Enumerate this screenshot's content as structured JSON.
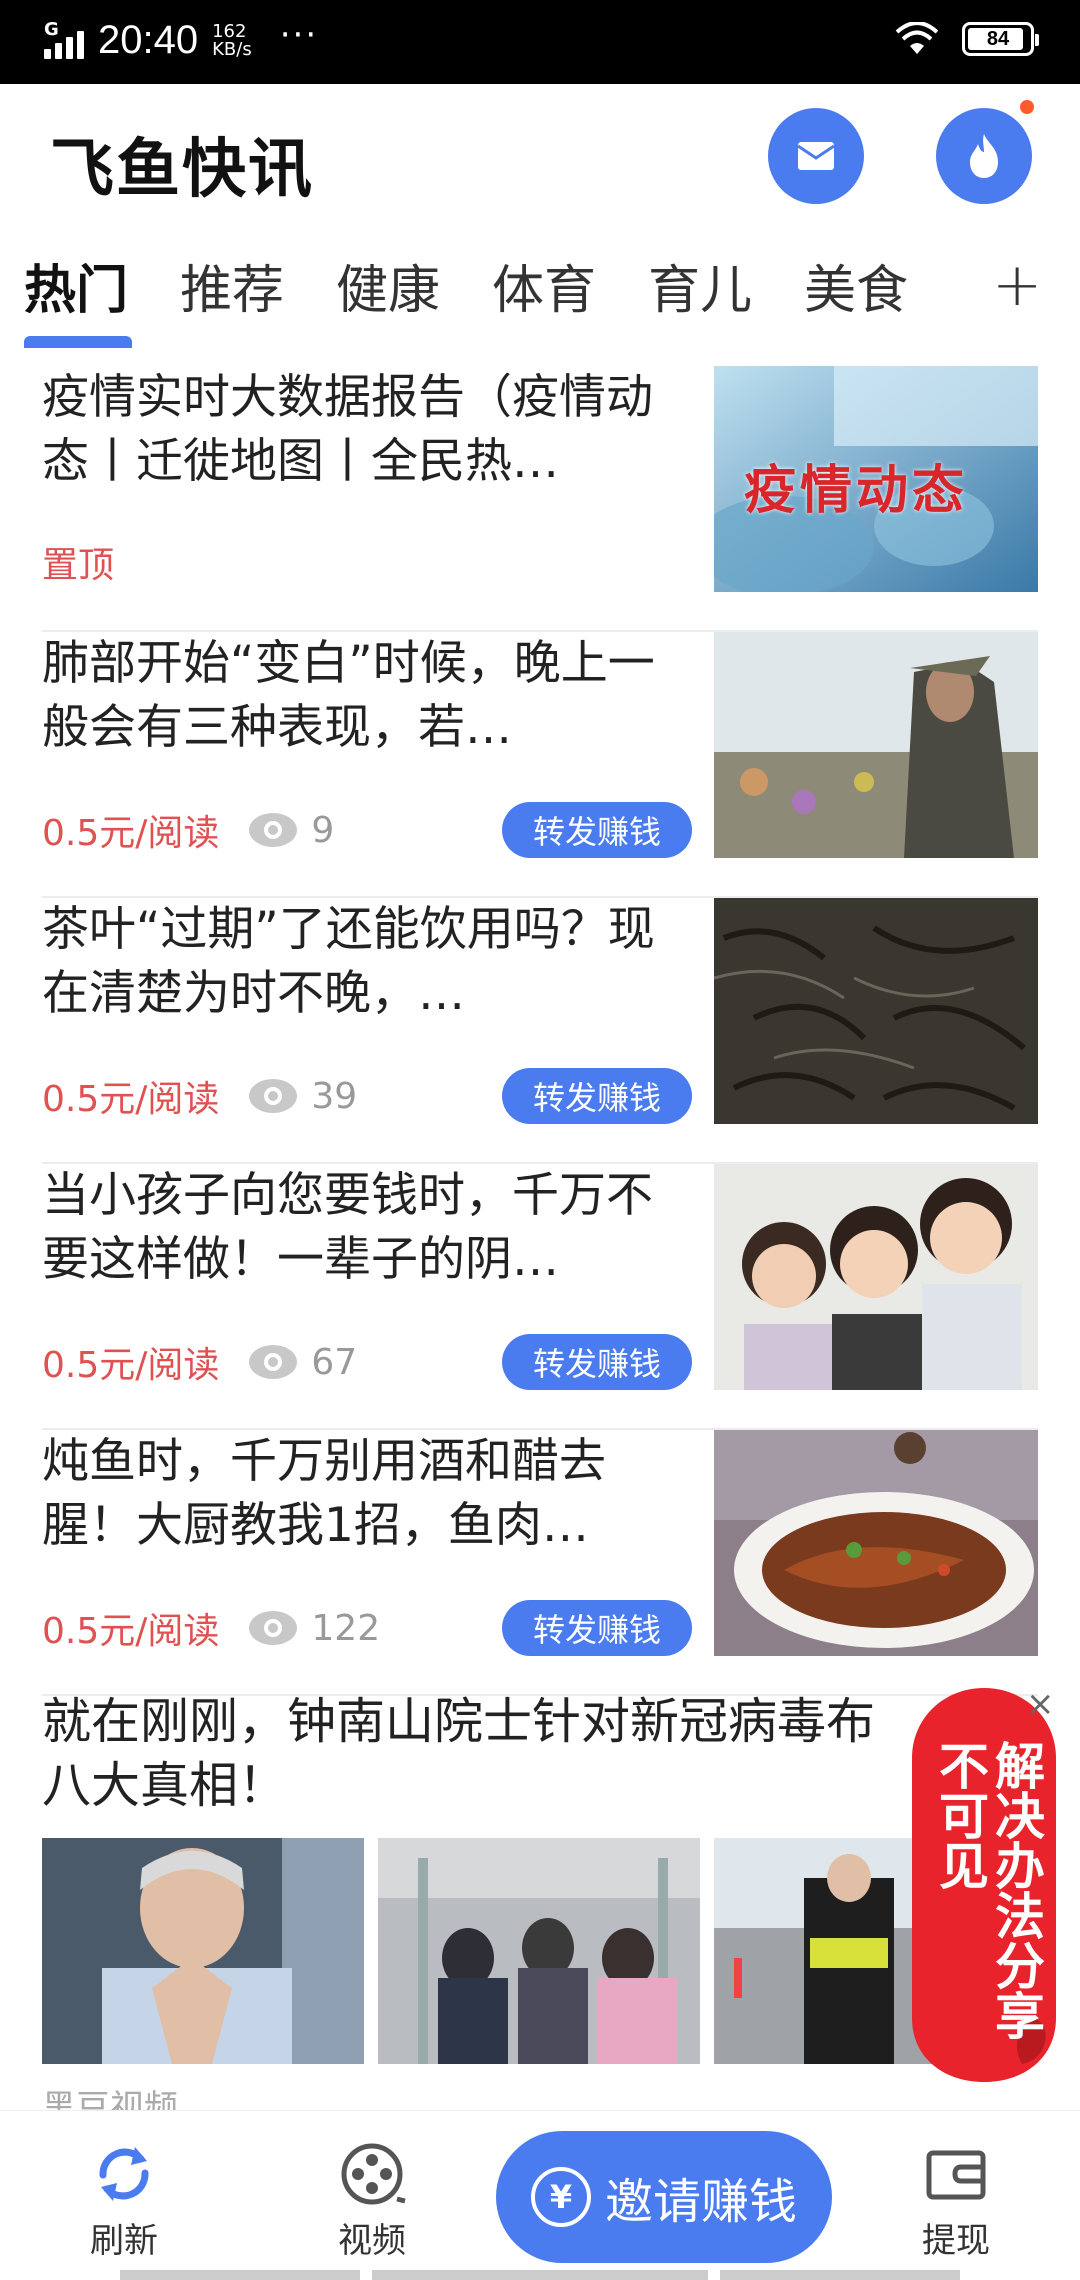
{
  "status_bar": {
    "network": "G",
    "time": "20:40",
    "speed_value": "162",
    "speed_unit": "KB/s",
    "more": "···",
    "battery": "84"
  },
  "header": {
    "title": "飞鱼快讯",
    "mail_icon": "mail-icon",
    "hot_icon": "fire-icon"
  },
  "tabs": [
    {
      "label": "热门",
      "active": true
    },
    {
      "label": "推荐",
      "active": false
    },
    {
      "label": "健康",
      "active": false
    },
    {
      "label": "体育",
      "active": false
    },
    {
      "label": "育儿",
      "active": false
    },
    {
      "label": "美食",
      "active": false
    }
  ],
  "tab_add": "+",
  "news": [
    {
      "title": "疫情实时大数据报告（疫情动态丨迁徙地图丨全民热…",
      "pinned": "置顶",
      "image_text": "疫情动态"
    },
    {
      "title": "肺部开始“变白”时候，晚上一般会有三种表现，若…",
      "reward": "0.5元/阅读",
      "views": "9",
      "share": "转发赚钱"
    },
    {
      "title": "茶叶“过期”了还能饮用吗？现在清楚为时不晚，…",
      "reward": "0.5元/阅读",
      "views": "39",
      "share": "转发赚钱"
    },
    {
      "title": "当小孩子向您要钱时，千万不要这样做！一辈子的阴…",
      "reward": "0.5元/阅读",
      "views": "67",
      "share": "转发赚钱"
    },
    {
      "title": "炖鱼时，千万别用酒和醋去腥！大厨教我1招，鱼肉…",
      "reward": "0.5元/阅读",
      "views": "122",
      "share": "转发赚钱"
    }
  ],
  "multi_news": {
    "title": "就在刚刚，钟南山院士针对新冠病毒布八大真相！",
    "source": "黑豆视频"
  },
  "float_badge": {
    "text": "解决办法分享不可见",
    "close": "×"
  },
  "bottom_nav": {
    "refresh": "刷新",
    "video": "视频",
    "invite": "邀请赚钱",
    "invite_symbol": "¥",
    "withdraw": "提现"
  },
  "colors": {
    "accent": "#4a7bef",
    "reward_red": "#e05252",
    "badge_red": "#e8232b"
  }
}
